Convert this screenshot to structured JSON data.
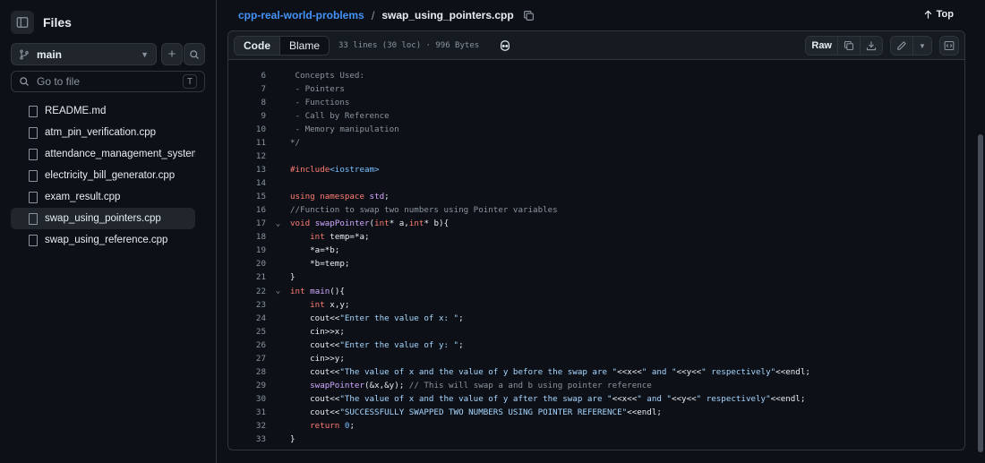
{
  "sidebar": {
    "title": "Files",
    "branch": "main",
    "goto_placeholder": "Go to file",
    "goto_shortcut": "T",
    "files": [
      {
        "name": "README.md",
        "active": false
      },
      {
        "name": "atm_pin_verification.cpp",
        "active": false
      },
      {
        "name": "attendance_management_system...",
        "active": false
      },
      {
        "name": "electricity_bill_generator.cpp",
        "active": false
      },
      {
        "name": "exam_result.cpp",
        "active": false
      },
      {
        "name": "swap_using_pointers.cpp",
        "active": true
      },
      {
        "name": "swap_using_reference.cpp",
        "active": false
      }
    ]
  },
  "breadcrumb": {
    "repo": "cpp-real-world-problems",
    "separator": "/",
    "file": "swap_using_pointers.cpp"
  },
  "top_link": "Top",
  "viewer": {
    "tab_code": "Code",
    "tab_blame": "Blame",
    "meta": "33 lines (30 loc) · 996 Bytes",
    "raw_label": "Raw"
  },
  "code_lines": [
    {
      "n": "6",
      "fold": false,
      "html": "<span class='c'> Concepts Used:</span>"
    },
    {
      "n": "7",
      "fold": false,
      "html": "<span class='c'> - Pointers</span>"
    },
    {
      "n": "8",
      "fold": false,
      "html": "<span class='c'> - Functions</span>"
    },
    {
      "n": "9",
      "fold": false,
      "html": "<span class='c'> - Call by Reference</span>"
    },
    {
      "n": "10",
      "fold": false,
      "html": "<span class='c'> - Memory manipulation</span>"
    },
    {
      "n": "11",
      "fold": false,
      "html": "<span class='c'>*/</span>"
    },
    {
      "n": "12",
      "fold": false,
      "html": ""
    },
    {
      "n": "13",
      "fold": false,
      "html": "<span class='k'>#include</span><span class='n'>&lt;iostream&gt;</span>"
    },
    {
      "n": "14",
      "fold": false,
      "html": ""
    },
    {
      "n": "15",
      "fold": false,
      "html": "<span class='k'>using namespace</span> <span class='f'>std</span>;"
    },
    {
      "n": "16",
      "fold": false,
      "html": "<span class='c'>//Function to swap two numbers using Pointer variables</span>"
    },
    {
      "n": "17",
      "fold": true,
      "html": "<span class='k'>void</span> <span class='f'>swapPointer</span>(<span class='k'>int</span>* a,<span class='k'>int</span>* b){"
    },
    {
      "n": "18",
      "fold": false,
      "html": "    <span class='k'>int</span> temp=*a;"
    },
    {
      "n": "19",
      "fold": false,
      "html": "    *a=*b;"
    },
    {
      "n": "20",
      "fold": false,
      "html": "    *b=temp;"
    },
    {
      "n": "21",
      "fold": false,
      "html": "}"
    },
    {
      "n": "22",
      "fold": true,
      "html": "<span class='k'>int</span> <span class='f'>main</span>(){"
    },
    {
      "n": "23",
      "fold": false,
      "html": "    <span class='k'>int</span> x,y;"
    },
    {
      "n": "24",
      "fold": false,
      "html": "    cout&lt;&lt;<span class='s'>\"Enter the value of x: \"</span>;"
    },
    {
      "n": "25",
      "fold": false,
      "html": "    cin&gt;&gt;x;"
    },
    {
      "n": "26",
      "fold": false,
      "html": "    cout&lt;&lt;<span class='s'>\"Enter the value of y: \"</span>;"
    },
    {
      "n": "27",
      "fold": false,
      "html": "    cin&gt;&gt;y;"
    },
    {
      "n": "28",
      "fold": false,
      "html": "    cout&lt;&lt;<span class='s'>\"The value of x and the value of y before the swap are \"</span>&lt;&lt;x&lt;&lt;<span class='s'>\" and \"</span>&lt;&lt;y&lt;&lt;<span class='s'>\" respectively\"</span>&lt;&lt;endl;"
    },
    {
      "n": "29",
      "fold": false,
      "html": "    <span class='f'>swapPointer</span>(&amp;x,&amp;y); <span class='c'>// This will swap a and b using pointer reference</span>"
    },
    {
      "n": "30",
      "fold": false,
      "html": "    cout&lt;&lt;<span class='s'>\"The value of x and the value of y after the swap are \"</span>&lt;&lt;x&lt;&lt;<span class='s'>\" and \"</span>&lt;&lt;y&lt;&lt;<span class='s'>\" respectively\"</span>&lt;&lt;endl;"
    },
    {
      "n": "31",
      "fold": false,
      "html": "    cout&lt;&lt;<span class='s'>\"SUCCESSFULLY SWAPPED TWO NUMBERS USING POINTER REFERENCE\"</span>&lt;&lt;endl;"
    },
    {
      "n": "32",
      "fold": false,
      "html": "    <span class='k'>return</span> <span class='n'>0</span>;"
    },
    {
      "n": "33",
      "fold": false,
      "html": "}"
    }
  ]
}
